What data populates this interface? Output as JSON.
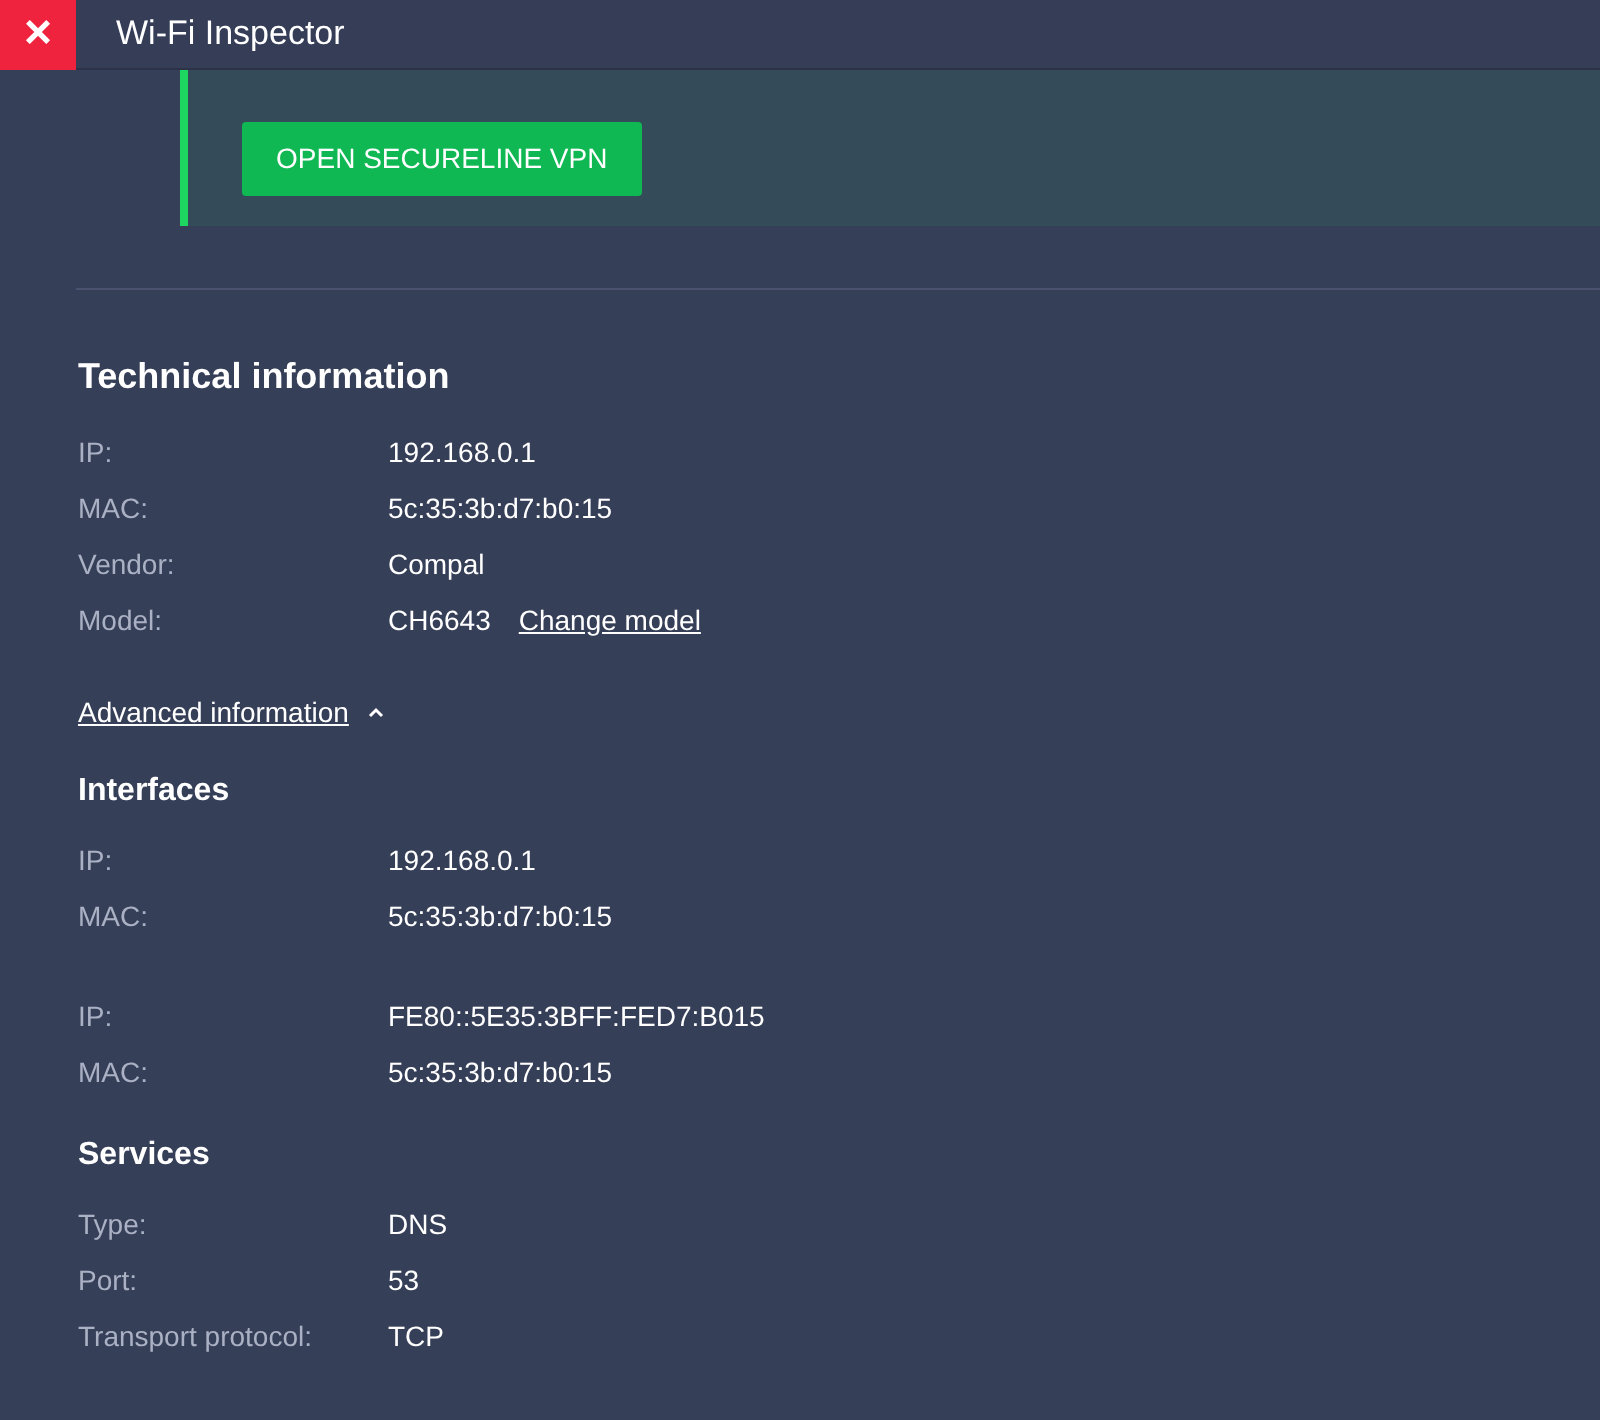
{
  "window": {
    "title": "Wi-Fi Inspector",
    "close": "×"
  },
  "banner": {
    "button": "OPEN SECURELINE VPN"
  },
  "technical": {
    "title": "Technical information",
    "rows": [
      {
        "label": "IP:",
        "value": "192.168.0.1"
      },
      {
        "label": "MAC:",
        "value": "5c:35:3b:d7:b0:15"
      },
      {
        "label": "Vendor:",
        "value": "Compal"
      },
      {
        "label": "Model:",
        "value": "CH6643",
        "link": "Change model"
      }
    ]
  },
  "advanced": {
    "label": "Advanced information",
    "expanded": true
  },
  "interfaces": {
    "title": "Interfaces",
    "groups": [
      [
        {
          "label": "IP:",
          "value": "192.168.0.1"
        },
        {
          "label": "MAC:",
          "value": "5c:35:3b:d7:b0:15"
        }
      ],
      [
        {
          "label": "IP:",
          "value": "FE80::5E35:3BFF:FED7:B015"
        },
        {
          "label": "MAC:",
          "value": "5c:35:3b:d7:b0:15"
        }
      ]
    ]
  },
  "services": {
    "title": "Services",
    "rows": [
      {
        "label": "Type:",
        "value": "DNS"
      },
      {
        "label": "Port:",
        "value": "53"
      },
      {
        "label": "Transport protocol:",
        "value": "TCP"
      }
    ]
  }
}
